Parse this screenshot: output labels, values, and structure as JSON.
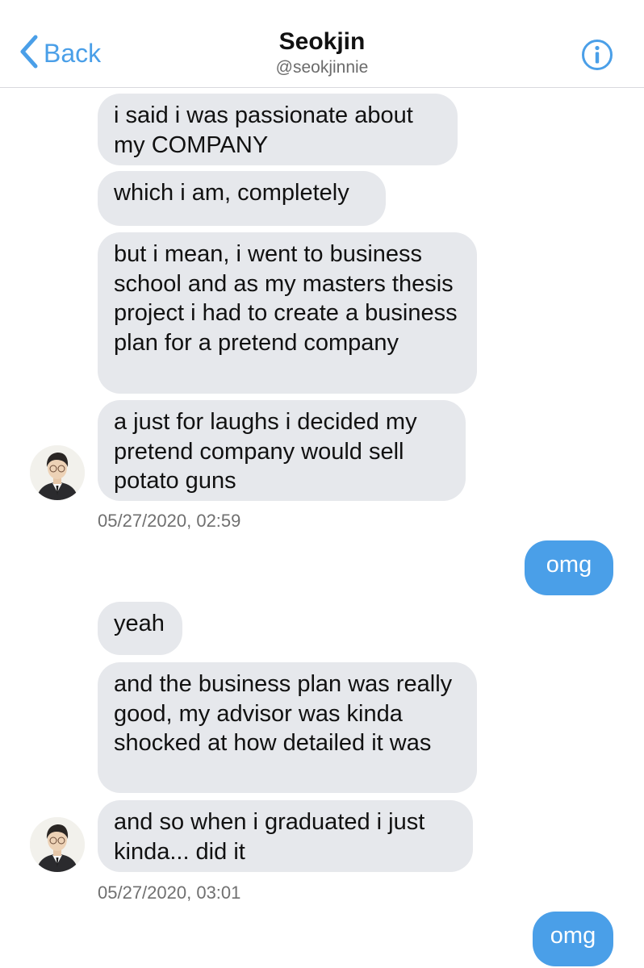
{
  "header": {
    "back_label": "Back",
    "title": "Seokjin",
    "handle": "@seokjinnie"
  },
  "colors": {
    "accent": "#4a9fe8",
    "incoming_bubble": "#e6e8ec",
    "outgoing_bubble": "#4a9fe8"
  },
  "messages": [
    {
      "from": "them",
      "text": "i said i was passionate about my COMPANY"
    },
    {
      "from": "them",
      "text": "which i am, completely"
    },
    {
      "from": "them",
      "text": "but i mean, i went to business school and as my masters thesis project i had to create a business plan for a pretend company"
    },
    {
      "from": "them",
      "text": "a just for laughs i decided my pretend company would sell potato guns"
    },
    {
      "from": "me",
      "text": "omg"
    },
    {
      "from": "them",
      "text": "yeah"
    },
    {
      "from": "them",
      "text": "and the business plan was really good, my advisor was kinda shocked at how detailed it was"
    },
    {
      "from": "them",
      "text": "and so when i graduated i just kinda... did it"
    },
    {
      "from": "me",
      "text": "omg"
    }
  ],
  "timestamps": [
    "05/27/2020, 02:59",
    "05/27/2020, 03:01"
  ]
}
